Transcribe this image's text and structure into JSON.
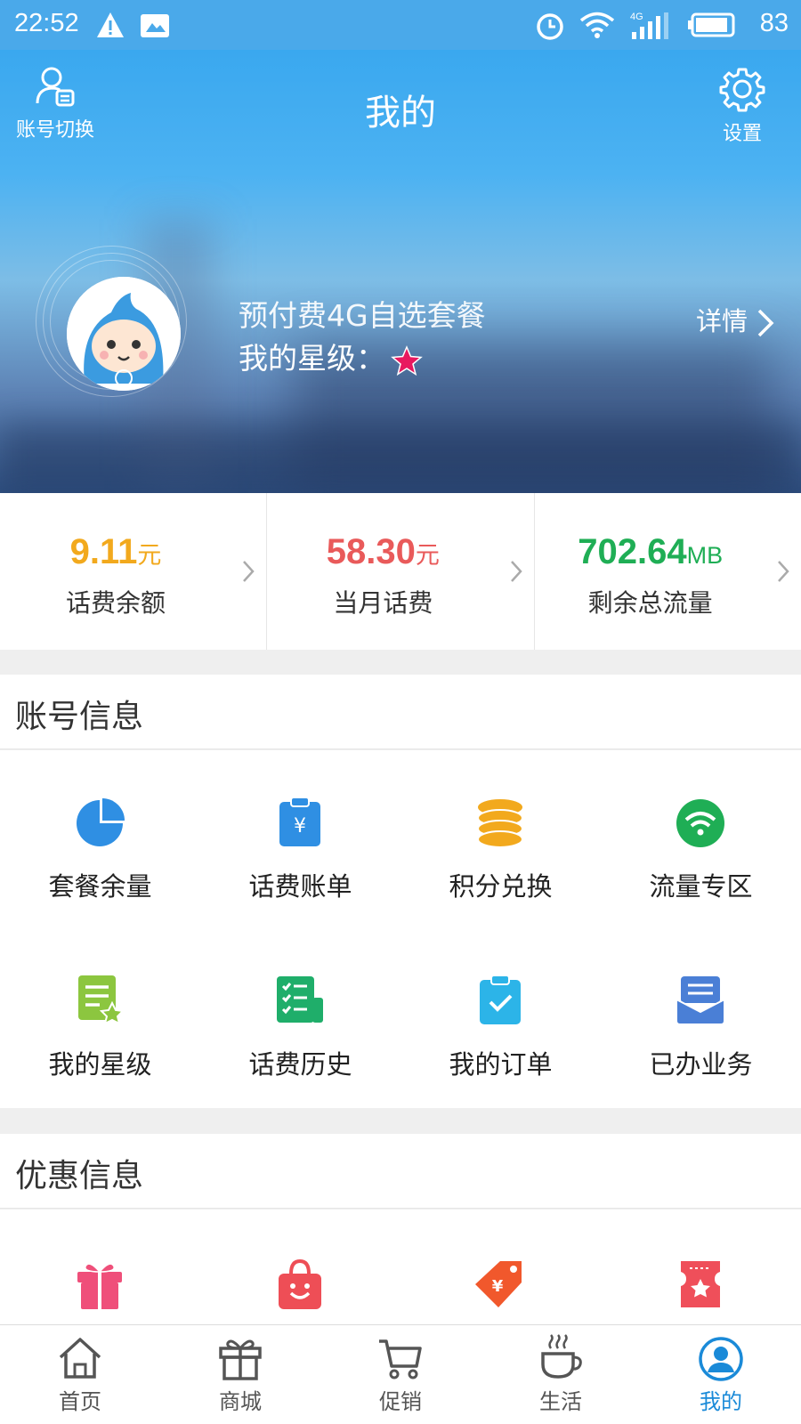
{
  "status_bar": {
    "time": "22:52",
    "battery": "83"
  },
  "header": {
    "title": "我的",
    "switch_label": "账号切换",
    "settings_label": "设置"
  },
  "profile": {
    "plan_name": "预付费4G自选套餐",
    "star_label": "我的星级：",
    "details_label": "详情"
  },
  "stats": [
    {
      "value": "9.11",
      "unit": "元",
      "label": "话费余额",
      "color": "#f2a91d"
    },
    {
      "value": "58.30",
      "unit": "元",
      "label": "当月话费",
      "color": "#e95a5a"
    },
    {
      "value": "702.64",
      "unit": "MB",
      "label": "剩余总流量",
      "color": "#1fae55"
    }
  ],
  "account_section": {
    "title": "账号信息",
    "items": [
      {
        "label": "套餐余量",
        "icon": "pie-chart-icon"
      },
      {
        "label": "话费账单",
        "icon": "clipboard-yuan-icon"
      },
      {
        "label": "积分兑换",
        "icon": "coin-stack-icon"
      },
      {
        "label": "流量专区",
        "icon": "wifi-icon"
      },
      {
        "label": "我的星级",
        "icon": "star-document-icon"
      },
      {
        "label": "话费历史",
        "icon": "checklist-icon"
      },
      {
        "label": "我的订单",
        "icon": "clipboard-check-icon"
      },
      {
        "label": "已办业务",
        "icon": "mail-tray-icon"
      }
    ]
  },
  "promo_section": {
    "title": "优惠信息",
    "items": [
      {
        "icon": "gift-icon"
      },
      {
        "icon": "shopping-bag-icon"
      },
      {
        "icon": "price-tag-icon"
      },
      {
        "icon": "ticket-star-icon"
      }
    ]
  },
  "tabbar": [
    {
      "label": "首页",
      "icon": "home-icon"
    },
    {
      "label": "商城",
      "icon": "gift-box-icon"
    },
    {
      "label": "促销",
      "icon": "cart-icon"
    },
    {
      "label": "生活",
      "icon": "coffee-icon"
    },
    {
      "label": "我的",
      "icon": "profile-icon",
      "active": true
    }
  ],
  "colors": {
    "primary": "#4aa9ea",
    "active_tab": "#1a8ad8"
  }
}
